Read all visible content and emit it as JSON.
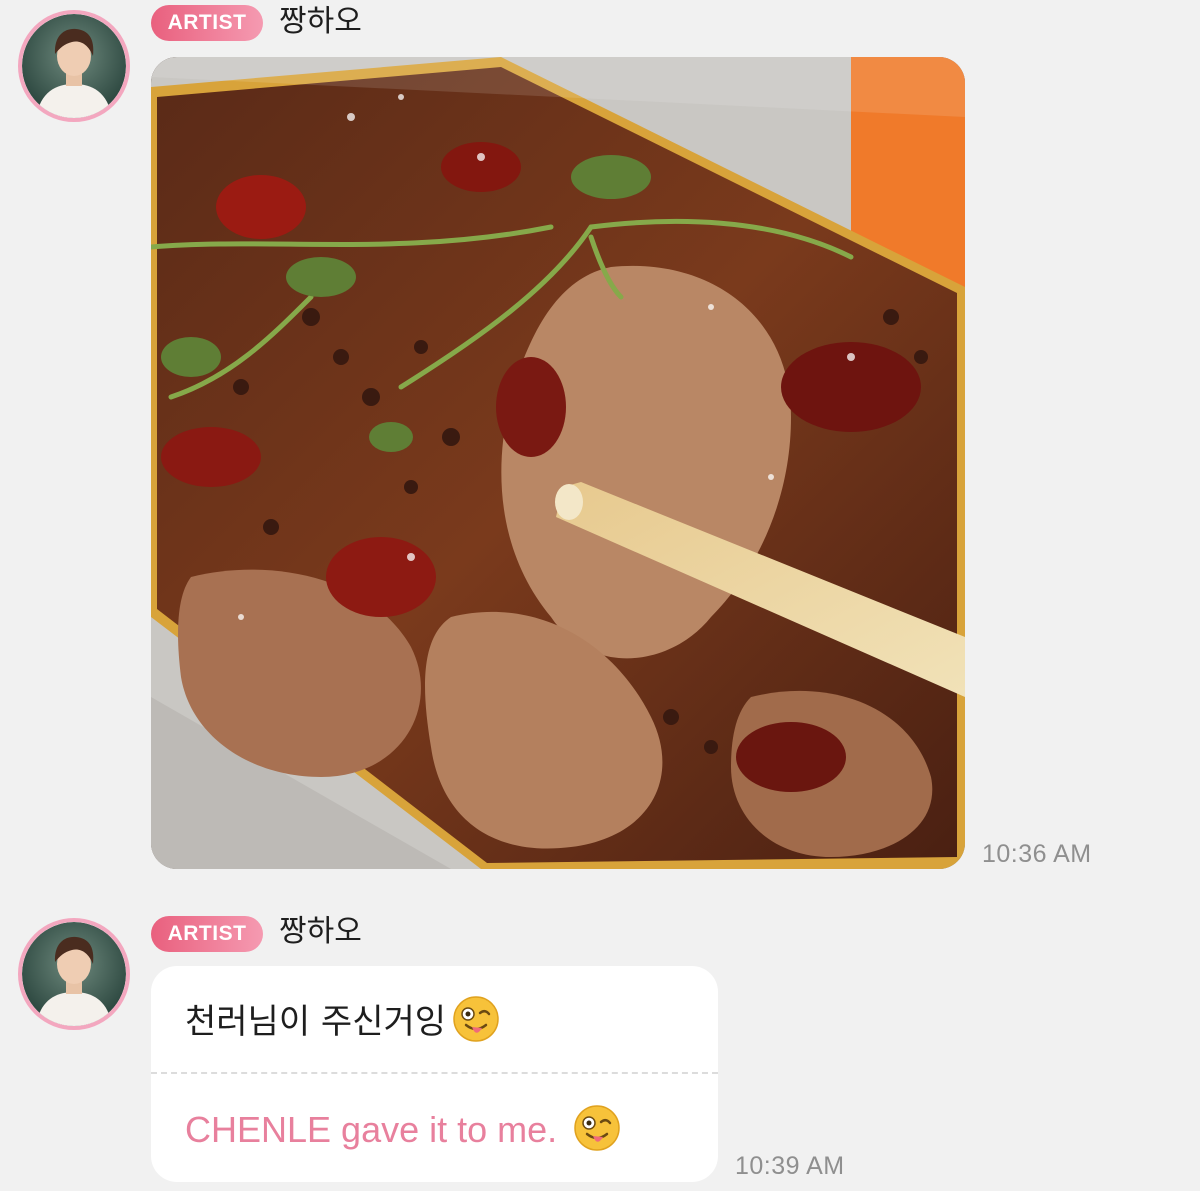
{
  "messages": [
    {
      "sender": {
        "badge": "ARTIST",
        "name": "짱하오",
        "avatar_icon": "artist-profile-photo"
      },
      "type": "image",
      "image_description_icon": "food-photo",
      "time": "10:36 AM"
    },
    {
      "sender": {
        "badge": "ARTIST",
        "name": "짱하오",
        "avatar_icon": "artist-profile-photo"
      },
      "type": "text",
      "original_text": "천러님이 주신거잉",
      "translation_text": "CHENLE gave it to me.",
      "emoji_icon": "winking-face-with-tongue-icon",
      "time": "10:39 AM"
    }
  ],
  "colors": {
    "background": "#f1f1f1",
    "avatar_ring": "#f3a7bf",
    "badge_start": "#e9607e",
    "badge_end": "#f59ab1",
    "translation_text": "#e8809d",
    "timestamp": "#8f8f8f"
  }
}
